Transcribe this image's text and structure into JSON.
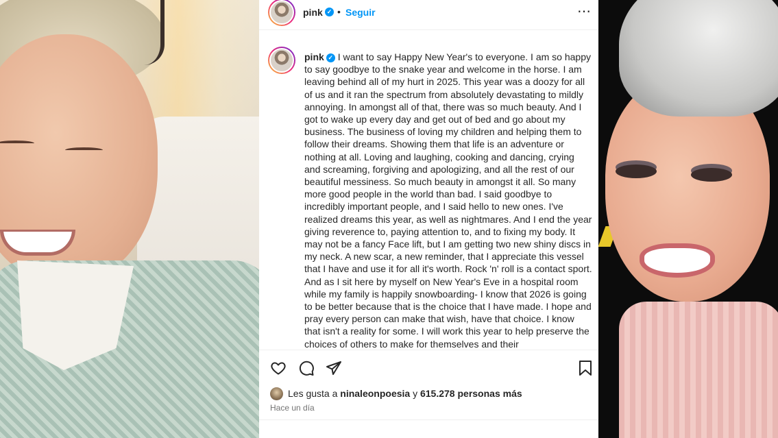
{
  "post": {
    "username": "pink",
    "separator": "•",
    "follow_label": "Seguir",
    "more_icon": "⋯",
    "caption": "I want to say Happy New Year's to everyone. I am so happy to say goodbye to the snake year and welcome in the horse. I am leaving behind all of my hurt in 2025. This year was a doozy for all of us and it ran the spectrum from absolutely devastating to mildly annoying. In amongst all of that, there was so much beauty. And I got to wake up every day and get out of bed and go about my business. The business of loving my children and helping them to follow their dreams. Showing them that life is an adventure or nothing at all. Loving and laughing, cooking and dancing, crying and screaming, forgiving and apologizing, and all the rest of our beautiful messiness. So much beauty in amongst it all. So many more good people in the world than bad. I said goodbye to incredibly important people, and I said hello to new ones. I've realized dreams this year, as well as nightmares. And I end the year giving reverence to, paying attention to, and to fixing my body. It may not be a fancy Face lift, but I am getting two new shiny discs in my neck. A new scar, a new reminder, that I appreciate this vessel that I have and use it for all it's worth. Rock 'n' roll is a contact sport. And as I sit here by myself on New Year's Eve in a hospital room while my family is happily snowboarding- I know that 2026 is going to be better because that is the choice that I have made. I hope and pray every person can make that wish, have that choice. I know that isn't a reality for some. I will work this year to help preserve the choices of others to make for themselves and their",
    "likes_prefix": "Les gusta a",
    "likes_user": "ninaleonpoesia",
    "likes_mid": "y",
    "likes_count": "615.278 personas más",
    "timestamp": "Hace un día"
  },
  "icons": {
    "like": "heart-icon",
    "comment": "comment-icon",
    "share": "paper-plane-icon",
    "save": "bookmark-icon",
    "verified": "verified-badge-icon"
  },
  "colors": {
    "accent": "#0095f6",
    "text": "#262626",
    "muted": "#737373"
  }
}
